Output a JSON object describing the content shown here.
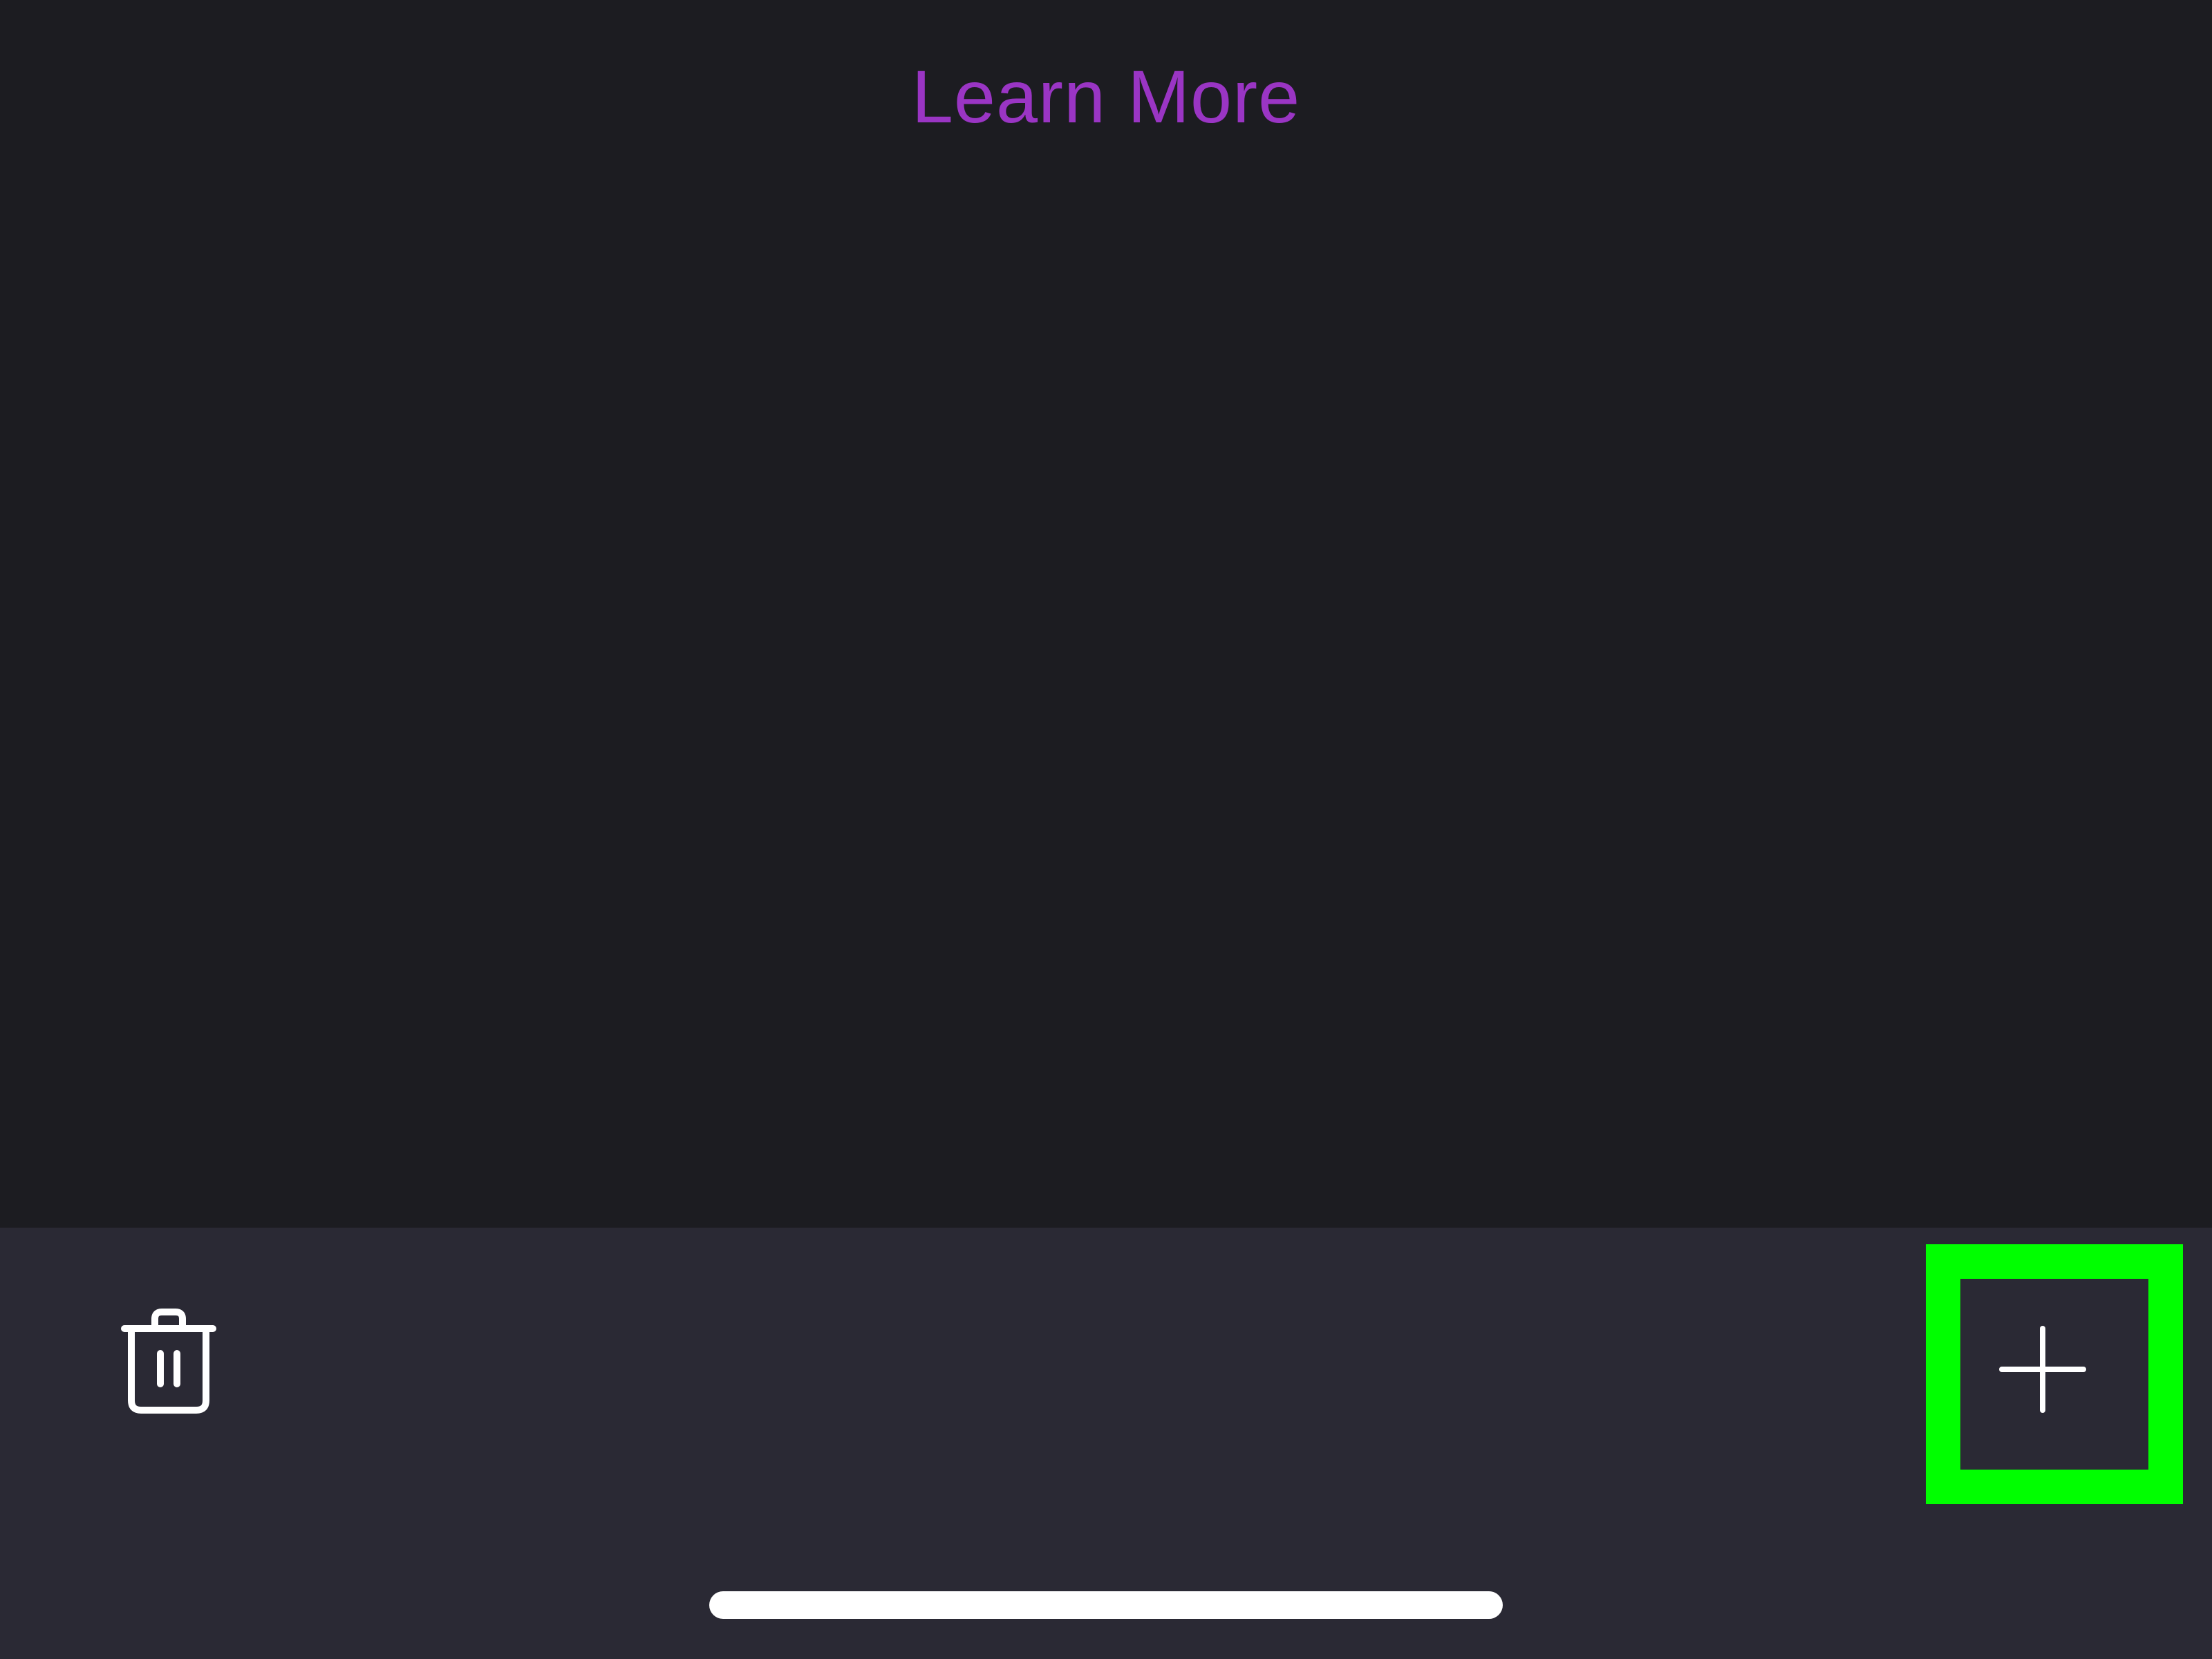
{
  "header": {
    "learn_more_label": "Learn More"
  },
  "toolbar": {
    "delete_icon": "trash-icon",
    "add_icon": "plus-icon"
  },
  "colors": {
    "background": "#1c1c21",
    "toolbar_background": "#2a2934",
    "accent": "#9a35c4",
    "highlight": "#00ff00",
    "icon": "#ffffff"
  }
}
